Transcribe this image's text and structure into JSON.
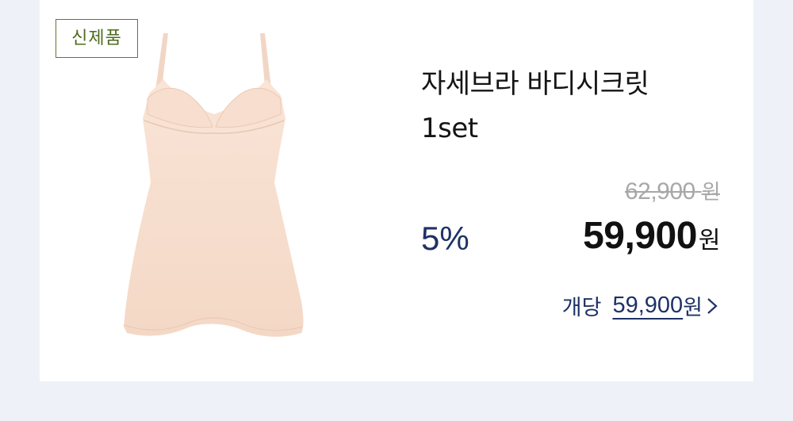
{
  "badge": {
    "label": "신제품"
  },
  "product": {
    "name_line1": "자세브라 바디시크릿",
    "name_line2": "1set",
    "image_icon": "slip-dress-image"
  },
  "pricing": {
    "original_price": "62,900",
    "original_unit": "원",
    "discount": "5%",
    "sale_price": "59,900",
    "sale_unit": "원",
    "per_unit_label": "개당",
    "per_unit_price": "59,900",
    "per_unit_currency": "원"
  },
  "colors": {
    "badge_green": "#4f6b1c",
    "navy": "#1e3266",
    "page_bg": "#eef2f8",
    "product_fabric": "#f6dccb"
  }
}
